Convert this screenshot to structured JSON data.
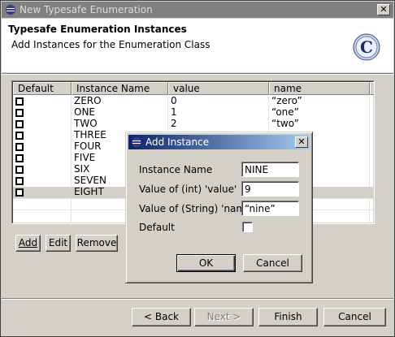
{
  "window": {
    "title": "New Typesafe Enumeration"
  },
  "header": {
    "title": "Typesafe Enumeration Instances",
    "subtitle": "Add Instances for the Enumeration Class",
    "logo_letter": "C"
  },
  "table": {
    "columns": [
      "Default",
      "Instance Name",
      "value",
      "name"
    ],
    "rows": [
      {
        "name": "ZERO",
        "value": "0",
        "str": "“zero”"
      },
      {
        "name": "ONE",
        "value": "1",
        "str": "“one”"
      },
      {
        "name": "TWO",
        "value": "2",
        "str": "“two”"
      },
      {
        "name": "THREE",
        "value": "",
        "str": ""
      },
      {
        "name": "FOUR",
        "value": "",
        "str": ""
      },
      {
        "name": "FIVE",
        "value": "",
        "str": ""
      },
      {
        "name": "SIX",
        "value": "",
        "str": ""
      },
      {
        "name": "SEVEN",
        "value": "",
        "str": ""
      },
      {
        "name": "EIGHT",
        "value": "",
        "str": ""
      }
    ]
  },
  "table_buttons": {
    "add": "Add",
    "edit": "Edit",
    "remove": "Remove"
  },
  "wizard_buttons": {
    "back": "< Back",
    "next": "Next >",
    "finish": "Finish",
    "cancel": "Cancel"
  },
  "dialog": {
    "title": "Add Instance",
    "instance_name_label": "Instance Name",
    "instance_name_value": "NINE",
    "int_value_label": "Value of (int) 'value'",
    "int_value_value": "9",
    "string_value_label": "Value of (String) 'name'",
    "string_value_value": "“nine”",
    "default_label": "Default",
    "default_checked": false,
    "ok": "OK",
    "cancel": "Cancel"
  },
  "colors": {
    "dialog_title_start": "#0a246a",
    "dialog_title_end": "#a6caf0",
    "inactive_title": "#808080"
  }
}
